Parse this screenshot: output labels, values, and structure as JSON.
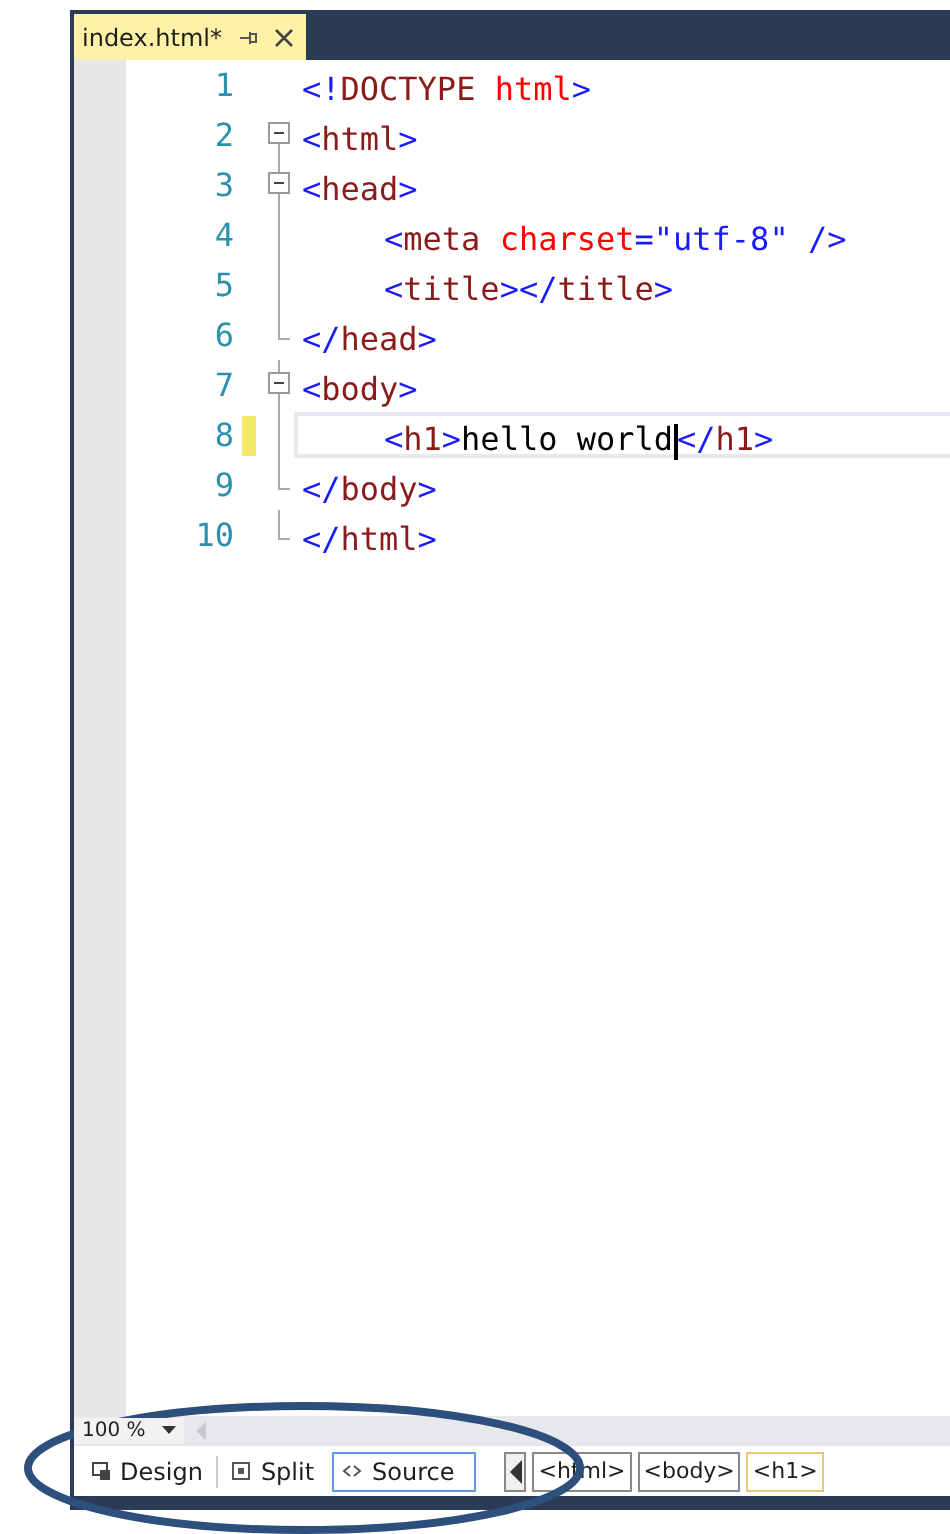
{
  "tab": {
    "title": "index.html*",
    "selected": true
  },
  "lines": [
    {
      "number": "1",
      "kind": "plain",
      "indented": false,
      "modified": false,
      "current": false,
      "tokens": [
        {
          "kind": "punct",
          "text": "<!"
        },
        {
          "kind": "tag",
          "text": "DOCTYPE "
        },
        {
          "kind": "attr",
          "text": "html"
        },
        {
          "kind": "punct",
          "text": ">"
        }
      ]
    },
    {
      "number": "2",
      "kind": "fold_start",
      "indented": false,
      "modified": false,
      "current": false,
      "tokens": [
        {
          "kind": "punct",
          "text": "<"
        },
        {
          "kind": "tag",
          "text": "html"
        },
        {
          "kind": "punct",
          "text": ">"
        }
      ]
    },
    {
      "number": "3",
      "kind": "fold_start",
      "indented": false,
      "modified": false,
      "current": false,
      "tokens": [
        {
          "kind": "punct",
          "text": "<"
        },
        {
          "kind": "tag",
          "text": "head"
        },
        {
          "kind": "punct",
          "text": ">"
        }
      ]
    },
    {
      "number": "4",
      "kind": "fold_inner",
      "indented": true,
      "modified": false,
      "current": false,
      "tokens": [
        {
          "kind": "punct",
          "text": "<"
        },
        {
          "kind": "tag",
          "text": "meta "
        },
        {
          "kind": "attr",
          "text": "charset"
        },
        {
          "kind": "punct",
          "text": "="
        },
        {
          "kind": "value",
          "text": "\"utf-8\" "
        },
        {
          "kind": "punct",
          "text": "/>"
        }
      ]
    },
    {
      "number": "5",
      "kind": "fold_inner",
      "indented": true,
      "modified": false,
      "current": false,
      "tokens": [
        {
          "kind": "punct",
          "text": "<"
        },
        {
          "kind": "tag",
          "text": "title"
        },
        {
          "kind": "punct",
          "text": "></"
        },
        {
          "kind": "tag",
          "text": "title"
        },
        {
          "kind": "punct",
          "text": ">"
        }
      ]
    },
    {
      "number": "6",
      "kind": "fold_end",
      "indented": false,
      "modified": false,
      "current": false,
      "tokens": [
        {
          "kind": "punct",
          "text": "</"
        },
        {
          "kind": "tag",
          "text": "head"
        },
        {
          "kind": "punct",
          "text": ">"
        }
      ]
    },
    {
      "number": "7",
      "kind": "fold_start",
      "indented": false,
      "modified": false,
      "current": false,
      "tokens": [
        {
          "kind": "punct",
          "text": "<"
        },
        {
          "kind": "tag",
          "text": "body"
        },
        {
          "kind": "punct",
          "text": ">"
        }
      ]
    },
    {
      "number": "8",
      "kind": "fold_inner",
      "indented": true,
      "modified": true,
      "current": true,
      "tokens": [
        {
          "kind": "punct",
          "text": "<"
        },
        {
          "kind": "tag",
          "text": "h1"
        },
        {
          "kind": "punct",
          "text": ">"
        },
        {
          "kind": "text",
          "text": "hello world",
          "caret": true
        },
        {
          "kind": "punct",
          "text": "</"
        },
        {
          "kind": "tag",
          "text": "h1"
        },
        {
          "kind": "punct",
          "text": ">"
        }
      ]
    },
    {
      "number": "9",
      "kind": "fold_end",
      "indented": false,
      "modified": false,
      "current": false,
      "tokens": [
        {
          "kind": "punct",
          "text": "</"
        },
        {
          "kind": "tag",
          "text": "body"
        },
        {
          "kind": "punct",
          "text": ">"
        }
      ]
    },
    {
      "number": "10",
      "kind": "fold_end",
      "indented": false,
      "modified": false,
      "current": false,
      "tokens": [
        {
          "kind": "punct",
          "text": "</"
        },
        {
          "kind": "tag",
          "text": "html"
        },
        {
          "kind": "punct",
          "text": ">"
        }
      ]
    }
  ],
  "zoom": {
    "value": "100 %"
  },
  "views": [
    {
      "kind": "design",
      "label": "Design",
      "selected": false
    },
    {
      "kind": "split",
      "label": "Split",
      "selected": false
    },
    {
      "kind": "source",
      "label": "Source",
      "selected": true
    }
  ],
  "breadcrumbs": [
    {
      "label": "<html>",
      "selected": false
    },
    {
      "label": "<body>",
      "selected": false
    },
    {
      "label": "<h1>",
      "selected": true
    }
  ]
}
